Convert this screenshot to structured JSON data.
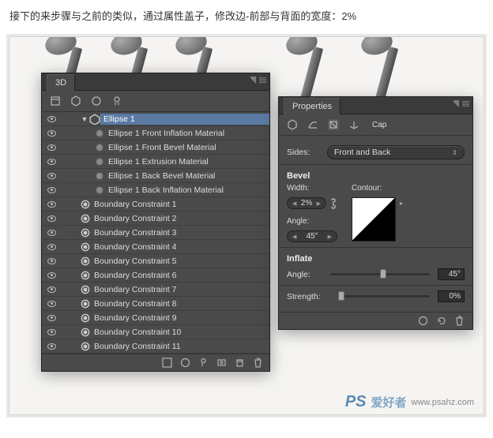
{
  "caption": "接下的来步骤与之前的类似，通过属性盖子，修改边-前部与背面的宽度：2%",
  "watermark": {
    "logo": "PS",
    "text": "爱好者",
    "url": "www.psahz.com"
  },
  "panel3d": {
    "title": "3D",
    "items": [
      {
        "label": "Ellipse 1",
        "selected": true,
        "indent": 1,
        "icon": "poly",
        "twist": "▼"
      },
      {
        "label": "Ellipse 1 Front Inflation Material",
        "indent": 2,
        "icon": "mat"
      },
      {
        "label": "Ellipse 1 Front Bevel Material",
        "indent": 2,
        "icon": "mat"
      },
      {
        "label": "Ellipse 1 Extrusion Material",
        "indent": 2,
        "icon": "mat"
      },
      {
        "label": "Ellipse 1 Back Bevel Material",
        "indent": 2,
        "icon": "mat"
      },
      {
        "label": "Ellipse 1 Back Inflation Material",
        "indent": 2,
        "icon": "mat"
      },
      {
        "label": "Boundary Constraint 1",
        "indent": 1,
        "icon": "constraint"
      },
      {
        "label": "Boundary Constraint 2",
        "indent": 1,
        "icon": "constraint"
      },
      {
        "label": "Boundary Constraint 3",
        "indent": 1,
        "icon": "constraint"
      },
      {
        "label": "Boundary Constraint 4",
        "indent": 1,
        "icon": "constraint"
      },
      {
        "label": "Boundary Constraint 5",
        "indent": 1,
        "icon": "constraint"
      },
      {
        "label": "Boundary Constraint 6",
        "indent": 1,
        "icon": "constraint"
      },
      {
        "label": "Boundary Constraint 7",
        "indent": 1,
        "icon": "constraint"
      },
      {
        "label": "Boundary Constraint 8",
        "indent": 1,
        "icon": "constraint"
      },
      {
        "label": "Boundary Constraint 9",
        "indent": 1,
        "icon": "constraint"
      },
      {
        "label": "Boundary Constraint 10",
        "indent": 1,
        "icon": "constraint"
      },
      {
        "label": "Boundary Constraint 11",
        "indent": 1,
        "icon": "constraint"
      }
    ]
  },
  "props": {
    "title": "Properties",
    "subtab": "Cap",
    "sides_label": "Sides:",
    "sides_value": "Front and Back",
    "bevel_hdr": "Bevel",
    "width_label": "Width:",
    "width_value": "2%",
    "contour_label": "Contour:",
    "angle_label": "Angle:",
    "angle_value": "45°",
    "inflate_hdr": "Inflate",
    "inf_angle_label": "Angle:",
    "inf_angle_value": "45°",
    "strength_label": "Strength:",
    "strength_value": "0%"
  }
}
